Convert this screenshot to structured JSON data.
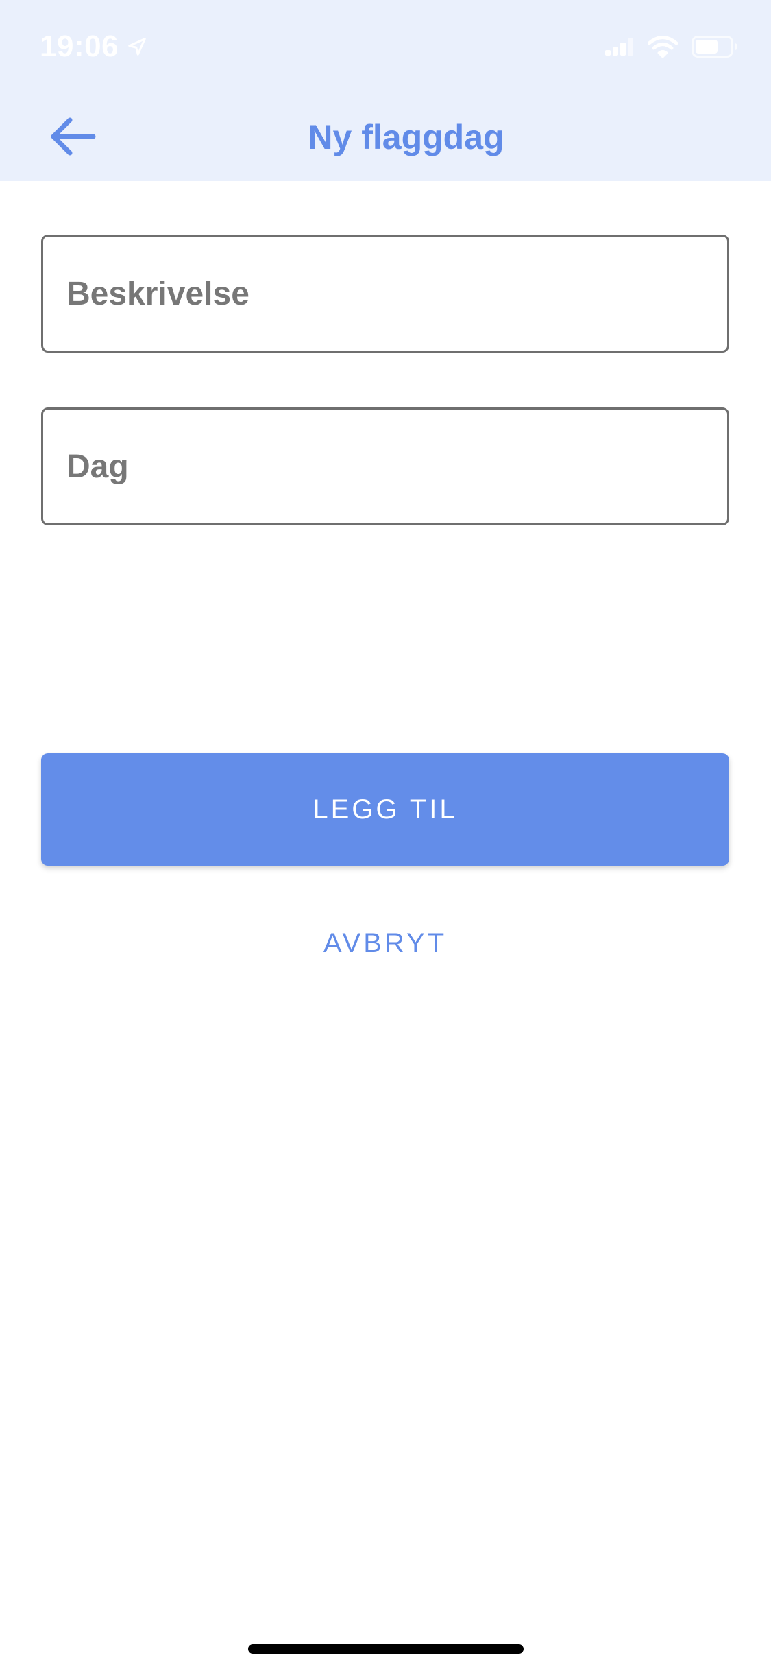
{
  "colors": {
    "header_bg": "#EAF0FC",
    "accent": "#618BE8",
    "primary_button_bg": "#638DE9",
    "field_border": "#6F6F6F",
    "placeholder_text": "#777777",
    "background": "#FFFFFF"
  },
  "status_bar": {
    "time": "19:06",
    "location_icon": "location-arrow-icon",
    "signal_icon": "cellular-signal-icon",
    "wifi_icon": "wifi-icon",
    "battery_icon": "battery-icon"
  },
  "nav": {
    "back_icon": "arrow-left-icon",
    "title": "Ny flaggdag"
  },
  "form": {
    "description_placeholder": "Beskrivelse",
    "description_value": "",
    "day_placeholder": "Dag",
    "day_value": ""
  },
  "actions": {
    "add_label": "LEGG TIL",
    "cancel_label": "AVBRYT"
  }
}
